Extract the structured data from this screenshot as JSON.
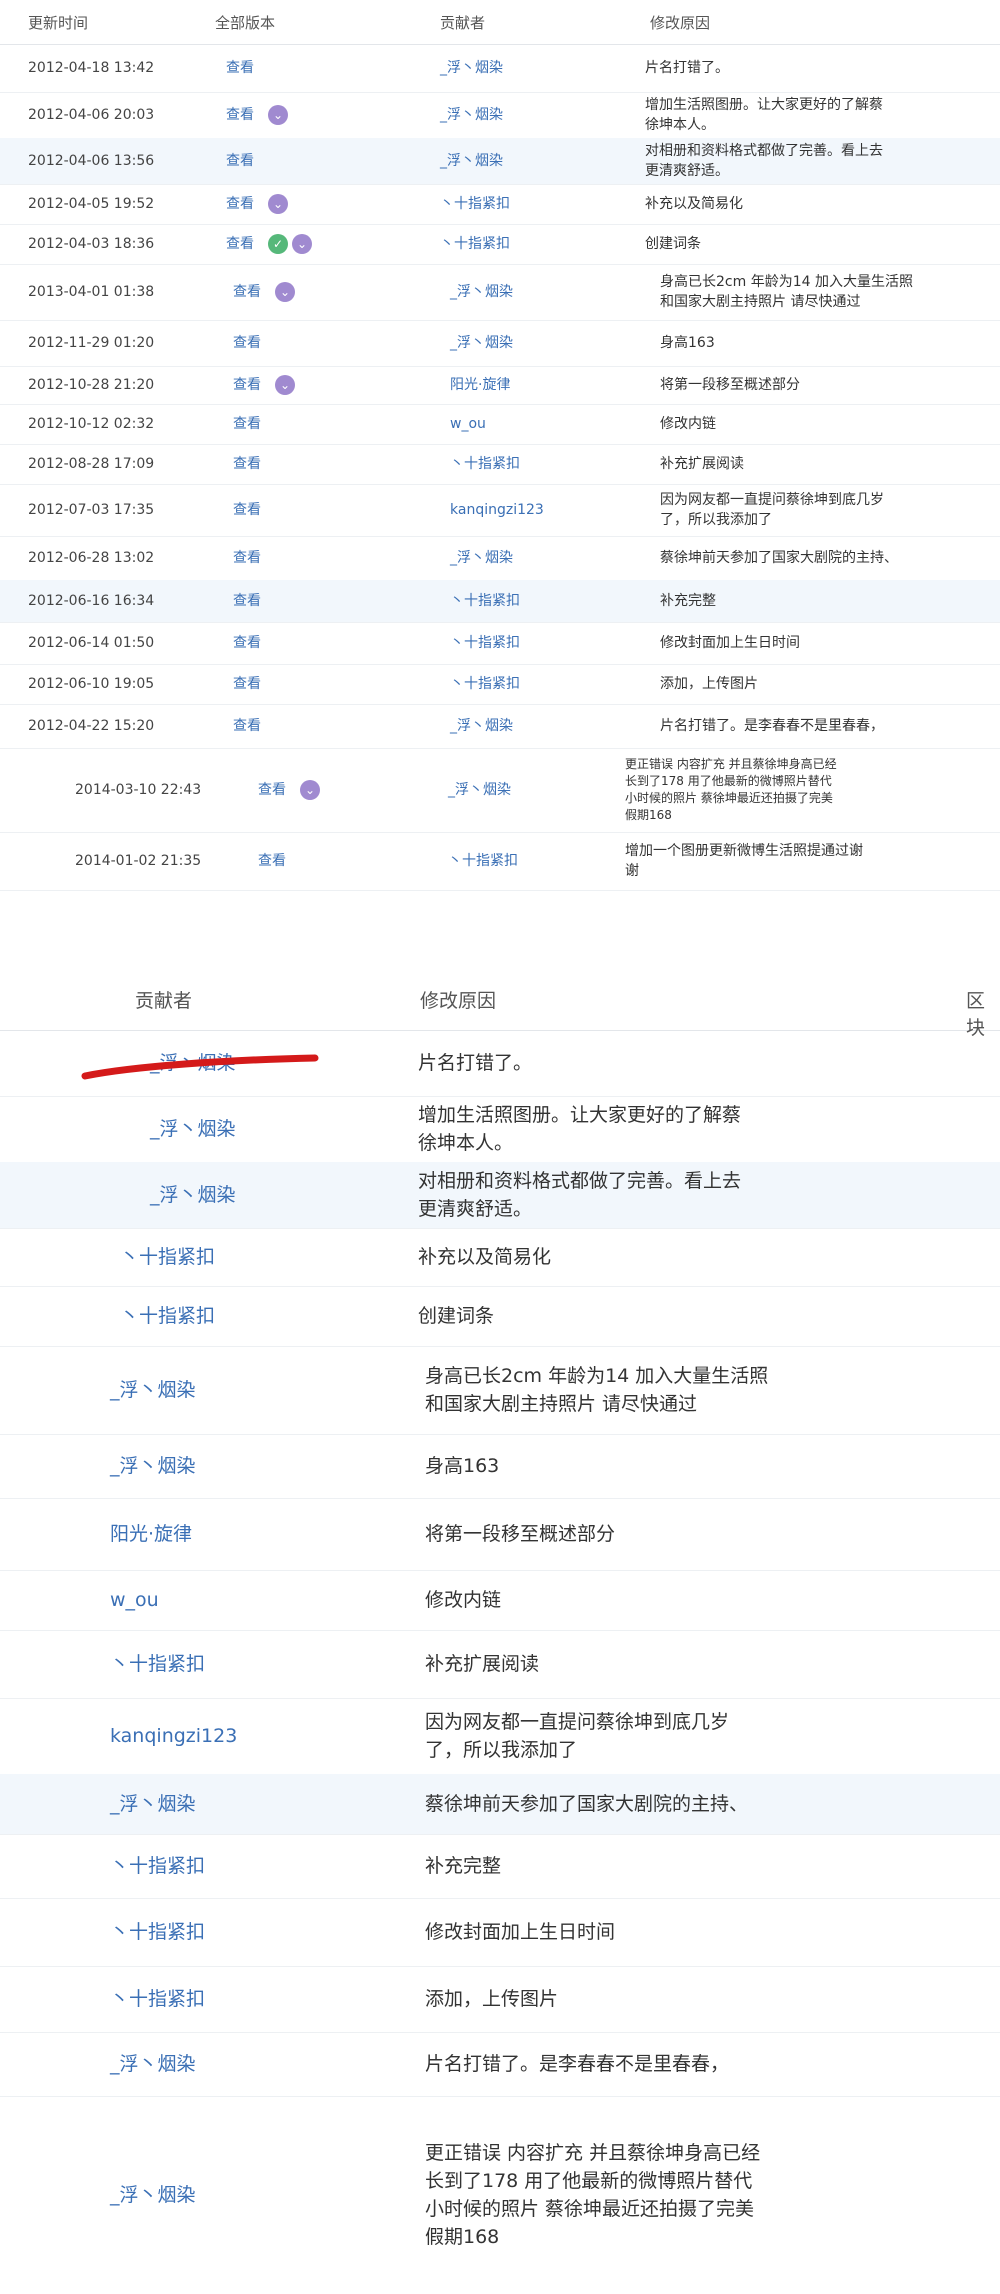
{
  "top": {
    "headers": {
      "time": "更新时间",
      "version": "全部版本",
      "contributor": "贡献者",
      "reason": "修改原因"
    },
    "rows": [
      {
        "time": "2012-04-18 13:42",
        "view": "查看",
        "contributor": "_浮丶烟染",
        "reason": [
          "片名打错了。"
        ]
      },
      {
        "time": "2012-04-06 20:03",
        "view": "查看",
        "contributor": "_浮丶烟染",
        "reason": [
          "增加生活照图册。让大家更好的了解蔡",
          "徐坤本人。"
        ]
      },
      {
        "time": "2012-04-06 13:56",
        "view": "查看",
        "contributor": "_浮丶烟染",
        "reason": [
          "对相册和资料格式都做了完善。看上去",
          "更清爽舒适。"
        ]
      },
      {
        "time": "2012-04-05 19:52",
        "view": "查看",
        "contributor": "丶十指紧扣",
        "reason": [
          "补充以及简易化"
        ]
      },
      {
        "time": "2012-04-03 18:36",
        "view": "查看",
        "contributor": "丶十指紧扣",
        "reason": [
          "创建词条"
        ]
      },
      {
        "time": "2013-04-01 01:38",
        "view": "查看",
        "contributor": "_浮丶烟染",
        "reason": [
          "身高已长2cm 年龄为14 加入大量生活照",
          "和国家大剧主持照片 请尽快通过"
        ]
      },
      {
        "time": "2012-11-29 01:20",
        "view": "查看",
        "contributor": "_浮丶烟染",
        "reason": [
          "身高163"
        ]
      },
      {
        "time": "2012-10-28 21:20",
        "view": "查看",
        "contributor": "阳光·旋律",
        "reason": [
          "将第一段移至概述部分"
        ]
      },
      {
        "time": "2012-10-12 02:32",
        "view": "查看",
        "contributor": "w_ou",
        "reason": [
          "修改内链"
        ]
      },
      {
        "time": "2012-08-28 17:09",
        "view": "查看",
        "contributor": "丶十指紧扣",
        "reason": [
          "补充扩展阅读"
        ]
      },
      {
        "time": "2012-07-03 17:35",
        "view": "查看",
        "contributor": "kanqingzi123",
        "reason": [
          "因为网友都一直提问蔡徐坤到底几岁",
          "了，所以我添加了"
        ]
      },
      {
        "time": "2012-06-28 13:02",
        "view": "查看",
        "contributor": "_浮丶烟染",
        "reason": [
          "蔡徐坤前天参加了国家大剧院的主持、"
        ]
      },
      {
        "time": "2012-06-16 16:34",
        "view": "查看",
        "contributor": "丶十指紧扣",
        "reason": [
          "补充完整"
        ]
      },
      {
        "time": "2012-06-14 01:50",
        "view": "查看",
        "contributor": "丶十指紧扣",
        "reason": [
          "修改封面加上生日时间"
        ]
      },
      {
        "time": "2012-06-10 19:05",
        "view": "查看",
        "contributor": "丶十指紧扣",
        "reason": [
          "添加，上传图片"
        ]
      },
      {
        "time": "2012-04-22 15:20",
        "view": "查看",
        "contributor": "_浮丶烟染",
        "reason": [
          "片名打错了。是李春春不是里春春，"
        ]
      },
      {
        "time": "2014-03-10 22:43",
        "view": "查看",
        "contributor": "_浮丶烟染",
        "reason": [
          "更正错误 内容扩充 并且蔡徐坤身高已经",
          "长到了178 用了他最新的微博照片替代",
          "小时候的照片 蔡徐坤最近还拍摄了完美",
          "假期168"
        ]
      },
      {
        "time": "2014-01-02 21:35",
        "view": "查看",
        "contributor": "丶十指紧扣",
        "reason": [
          "增加一个图册更新微博生活照提通过谢",
          "谢"
        ]
      }
    ]
  },
  "bottom": {
    "headers": {
      "contributor": "贡献者",
      "reason": "修改原因",
      "extra": "区块"
    },
    "rows": [
      {
        "contributor": "_浮丶烟染",
        "reason": [
          "片名打错了。"
        ]
      },
      {
        "contributor": "_浮丶烟染",
        "reason": [
          "增加生活照图册。让大家更好的了解蔡",
          "徐坤本人。"
        ]
      },
      {
        "contributor": "_浮丶烟染",
        "reason": [
          "对相册和资料格式都做了完善。看上去",
          "更清爽舒适。"
        ]
      },
      {
        "contributor": "丶十指紧扣",
        "reason": [
          "补充以及简易化"
        ]
      },
      {
        "contributor": "丶十指紧扣",
        "reason": [
          "创建词条"
        ]
      },
      {
        "contributor": "_浮丶烟染",
        "reason": [
          "身高已长2cm 年龄为14 加入大量生活照",
          "和国家大剧主持照片 请尽快通过"
        ]
      },
      {
        "contributor": "_浮丶烟染",
        "reason": [
          "身高163"
        ]
      },
      {
        "contributor": "阳光·旋律",
        "reason": [
          "将第一段移至概述部分"
        ]
      },
      {
        "contributor": "w_ou",
        "reason": [
          "修改内链"
        ]
      },
      {
        "contributor": "丶十指紧扣",
        "reason": [
          "补充扩展阅读"
        ]
      },
      {
        "contributor": "kanqingzi123",
        "reason": [
          "因为网友都一直提问蔡徐坤到底几岁",
          "了，所以我添加了"
        ]
      },
      {
        "contributor": "_浮丶烟染",
        "reason": [
          "蔡徐坤前天参加了国家大剧院的主持、"
        ]
      },
      {
        "contributor": "丶十指紧扣",
        "reason": [
          "补充完整"
        ]
      },
      {
        "contributor": "丶十指紧扣",
        "reason": [
          "修改封面加上生日时间"
        ]
      },
      {
        "contributor": "丶十指紧扣",
        "reason": [
          "添加，上传图片"
        ]
      },
      {
        "contributor": "_浮丶烟染",
        "reason": [
          "片名打错了。是李春春不是里春春，"
        ]
      },
      {
        "contributor": "_浮丶烟染",
        "reason": [
          "更正错误 内容扩充 并且蔡徐坤身高已经",
          "长到了178 用了他最新的微博照片替代",
          "小时候的照片 蔡徐坤最近还拍摄了完美",
          "假期168"
        ]
      }
    ]
  },
  "colors": {
    "link": "#3a6fb5",
    "annotation": "#d41a1a",
    "badge_purple": "#a08ad0",
    "badge_green": "#56b87a"
  }
}
